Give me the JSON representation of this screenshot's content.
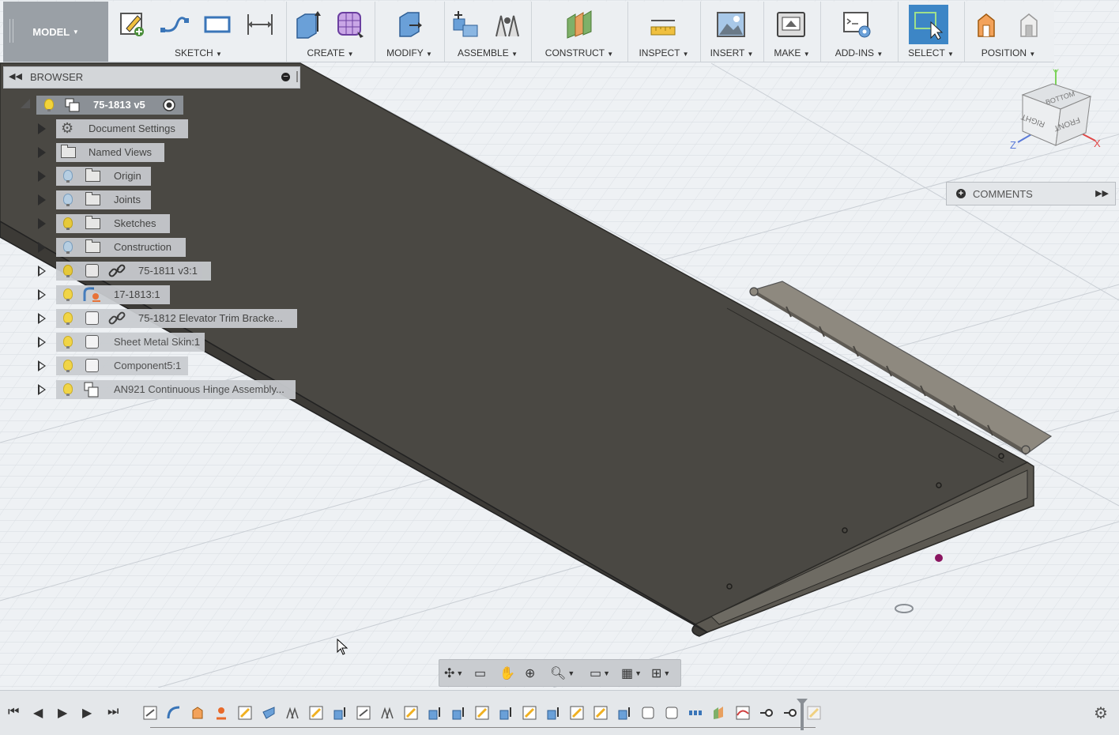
{
  "toolbar": {
    "workspace": "MODEL",
    "groups": [
      {
        "key": "sketch",
        "label": "SKETCH"
      },
      {
        "key": "create",
        "label": "CREATE"
      },
      {
        "key": "modify",
        "label": "MODIFY"
      },
      {
        "key": "assemble",
        "label": "ASSEMBLE"
      },
      {
        "key": "construct",
        "label": "CONSTRUCT"
      },
      {
        "key": "inspect",
        "label": "INSPECT"
      },
      {
        "key": "insert",
        "label": "INSERT"
      },
      {
        "key": "make",
        "label": "MAKE"
      },
      {
        "key": "addins",
        "label": "ADD-INS"
      },
      {
        "key": "select",
        "label": "SELECT"
      },
      {
        "key": "position",
        "label": "POSITION"
      }
    ]
  },
  "browser": {
    "title": "BROWSER",
    "root": {
      "label": "75-1813 v5"
    },
    "items": [
      {
        "label": "Document Settings",
        "icon": "gear-icon"
      },
      {
        "label": "Named Views",
        "icon": "folder-icon"
      },
      {
        "label": "Origin",
        "icon": "folder-icon",
        "bulb": "off"
      },
      {
        "label": "Joints",
        "icon": "folder-icon",
        "bulb": "off"
      },
      {
        "label": "Sketches",
        "icon": "folder-icon",
        "bulb": "on"
      },
      {
        "label": "Construction",
        "icon": "folder-icon",
        "bulb": "off"
      },
      {
        "label": "75-1811 v3:1",
        "icon": "component-icon",
        "bulb": "on",
        "linked": true
      },
      {
        "label": "17-1813:1",
        "icon": "sheet-metal-icon",
        "bulb": "on"
      },
      {
        "label": "75-1812 Elevator Trim Bracke...",
        "icon": "component-icon",
        "bulb": "on",
        "linked": true
      },
      {
        "label": "Sheet Metal Skin:1",
        "icon": "component-icon",
        "bulb": "on"
      },
      {
        "label": "Component5:1",
        "icon": "component-icon",
        "bulb": "on"
      },
      {
        "label": "AN921 Continuous Hinge Assembly...",
        "icon": "assembly-icon",
        "bulb": "on"
      }
    ]
  },
  "comments": {
    "title": "COMMENTS"
  },
  "viewcube": {
    "top": "BOTTOM",
    "front": "FRONT",
    "right": "RIGHT",
    "axis_x": "X",
    "axis_y": "Y",
    "axis_z": "Z"
  },
  "colors": {
    "accent": "#3d86c6",
    "model": "#4a4843",
    "hinge": "#8e897f",
    "toolbar": "#eceff2"
  }
}
